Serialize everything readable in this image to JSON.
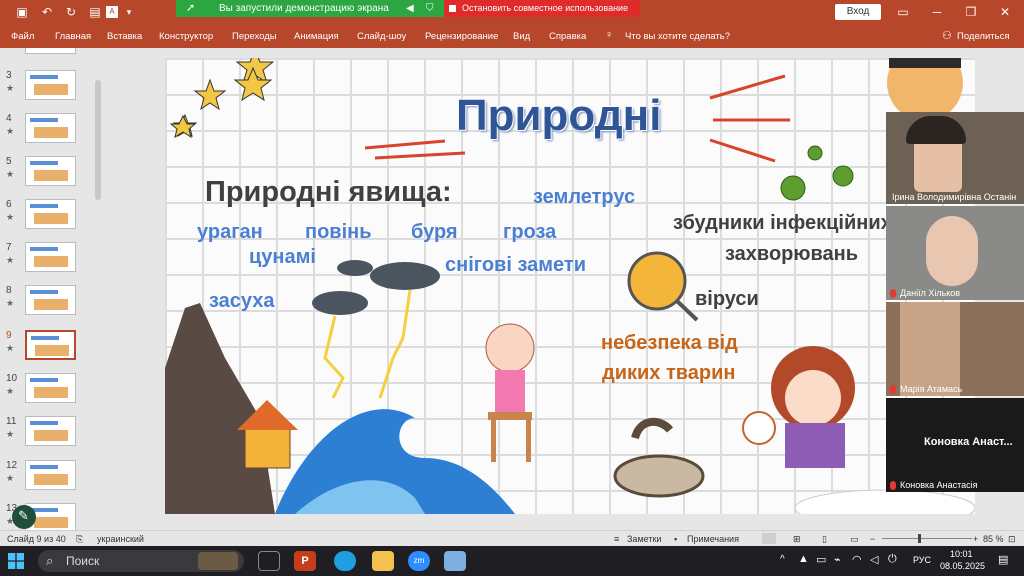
{
  "share": {
    "banner": "Вы запустили демонстрацию экрана",
    "stop": "Остановить совместное использование"
  },
  "titlebar": {
    "login": "Вход"
  },
  "ribbon": {
    "tabs": [
      "Файл",
      "Главная",
      "Вставка",
      "Конструктор",
      "Переходы",
      "Анимация",
      "Слайд-шоу",
      "Рецензирование",
      "Вид",
      "Справка"
    ],
    "tell": "Что вы хотите сделать?",
    "share": "Поделиться"
  },
  "thumbnails": [
    {
      "num": "3",
      "mark": "★"
    },
    {
      "num": "4",
      "mark": "★"
    },
    {
      "num": "5",
      "mark": "★"
    },
    {
      "num": "6",
      "mark": "★"
    },
    {
      "num": "7",
      "mark": "★"
    },
    {
      "num": "8",
      "mark": "★"
    },
    {
      "num": "9",
      "mark": "★"
    },
    {
      "num": "10",
      "mark": "★"
    },
    {
      "num": "11",
      "mark": "★"
    },
    {
      "num": "12",
      "mark": "★"
    },
    {
      "num": "13",
      "mark": "★"
    }
  ],
  "slide": {
    "title": "Природні",
    "heading": "Природні явища:",
    "words": {
      "earthquake": "землетрус",
      "hurricane": "ураган",
      "flood": "повінь",
      "storm": "буря",
      "thunderstorm": "гроза",
      "tsunami": "цунамі",
      "snowdrifts": "снігові замети",
      "drought": "засуха",
      "pathogens1": "збудники інфекційних",
      "pathogens2": "захворювань",
      "viruses": "віруси",
      "danger1": "небезпека від",
      "danger2": "диких тварин"
    },
    "colors": {
      "title": "#2f5597",
      "heading": "#404040",
      "words": "#4a7fd4",
      "orange": "#c5661a",
      "dark": "#404040"
    }
  },
  "participants": [
    {
      "name": "Ірина Володимирівна Останін"
    },
    {
      "name": "Даніїл Хільков"
    },
    {
      "name": "Марія Атамась"
    },
    {
      "name": "Коновка Анастасія",
      "tile": "Коновка Анаст..."
    }
  ],
  "status": {
    "slide": "Слайд 9 из 40",
    "lang": "украинский",
    "notes": "Заметки",
    "comments": "Примечания",
    "zoom": "85 %"
  },
  "taskbar": {
    "search": "Поиск",
    "lang": "РУС",
    "time": "10:01",
    "date": "08.05.2025"
  }
}
